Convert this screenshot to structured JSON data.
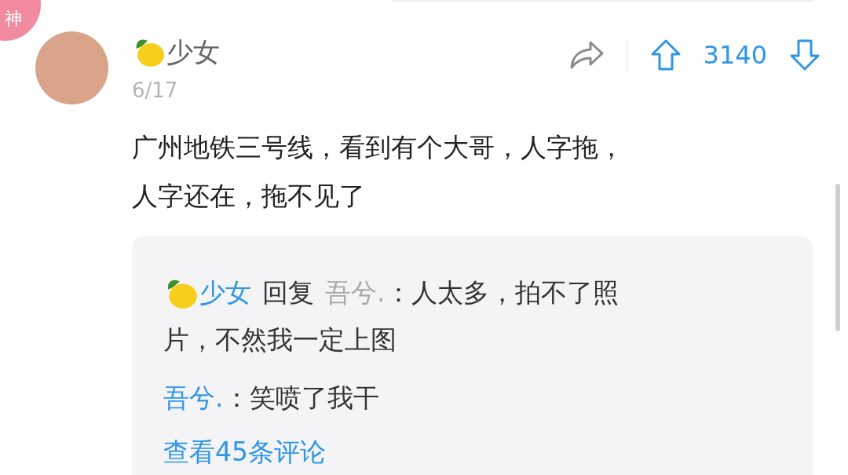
{
  "badge": "神",
  "post": {
    "author": "少女",
    "date": "6/17",
    "score": "3140",
    "body": [
      "广州地铁三号线，看到有个大哥，人字拖，",
      "人字还在，拖不见了"
    ]
  },
  "replies": [
    {
      "author": "少女",
      "has_emoji": true,
      "verb": "回复",
      "target": "吾兮.",
      "lines": [
        "：人太多，拍不了照",
        "片，不然我一定上图"
      ]
    },
    {
      "author": "吾兮.",
      "has_emoji": false,
      "lines": [
        "：笑喷了我干"
      ]
    }
  ],
  "more_link": "查看45条评论"
}
